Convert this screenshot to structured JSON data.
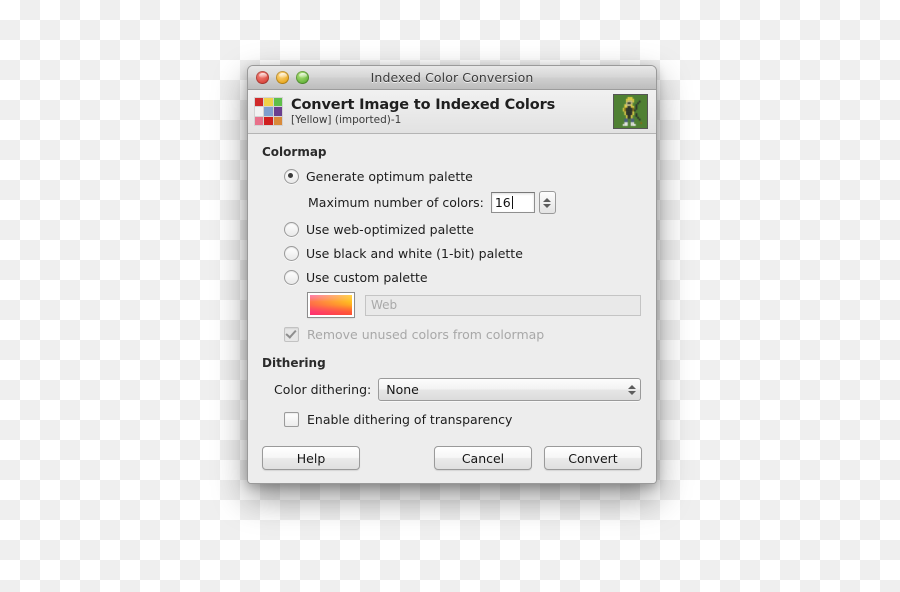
{
  "window": {
    "title": "Indexed Color Conversion",
    "traffic_lights": [
      {
        "name": "close",
        "color": "#d9453c"
      },
      {
        "name": "minimize",
        "color": "#e8a81e"
      },
      {
        "name": "zoom",
        "color": "#64b33a"
      }
    ]
  },
  "header": {
    "icon": "color-palette-icon",
    "title": "Convert Image to Indexed Colors",
    "subtitle": "[Yellow] (imported)-1",
    "thumbnail": "image-thumbnail"
  },
  "colormap": {
    "group_label": "Colormap",
    "options": [
      {
        "label": "Generate optimum palette",
        "selected": true
      },
      {
        "label": "Use web-optimized palette",
        "selected": false
      },
      {
        "label": "Use black and white (1-bit) palette",
        "selected": false
      },
      {
        "label": "Use custom palette",
        "selected": false
      }
    ],
    "max_colors_label": "Maximum number of colors:",
    "max_colors_value": "16",
    "custom_palette_name": "Web",
    "remove_unused_label": "Remove unused colors from colormap",
    "remove_unused_checked": true,
    "remove_unused_enabled": false
  },
  "dithering": {
    "group_label": "Dithering",
    "color_dithering_label": "Color dithering:",
    "color_dithering_value": "None",
    "color_dithering_options": [
      "None"
    ],
    "enable_transparency_label": "Enable dithering of transparency",
    "enable_transparency_checked": false
  },
  "footer": {
    "help_label": "Help",
    "cancel_label": "Cancel",
    "convert_label": "Convert"
  },
  "colors": {
    "window_bg": "#ededed",
    "titlebar_bg": "#cfcfcf",
    "text": "#1d1d1d",
    "disabled_text": "#a8a8a8",
    "thumb_bg": "#4f8033"
  },
  "palette_icon_swatches": [
    "#d02a2a",
    "#f0d24a",
    "#5fbf4a",
    "#f2f2f2",
    "#7f9fd0",
    "#6a3f8f",
    "#e8708a",
    "#cf1f1f",
    "#d98a3a"
  ]
}
